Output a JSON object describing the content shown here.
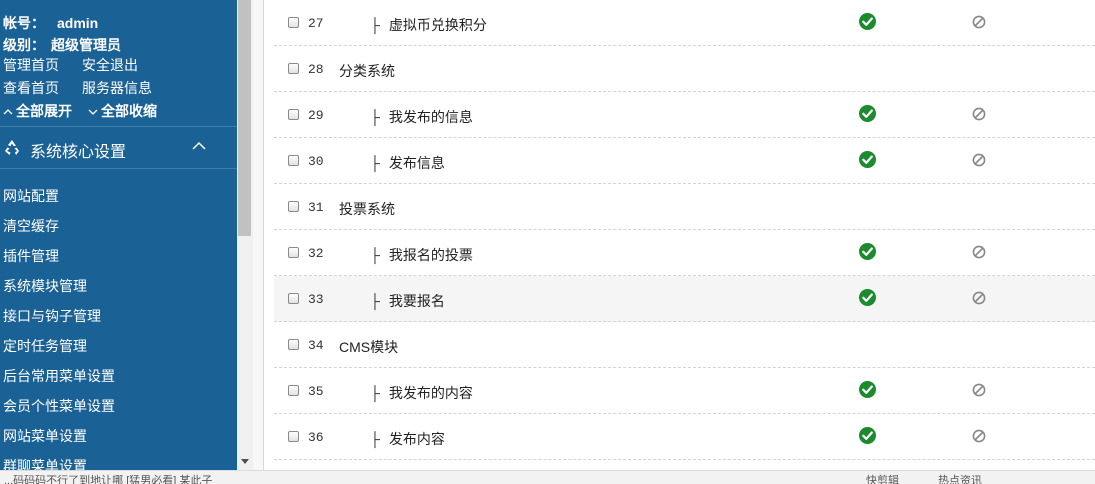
{
  "account": {
    "username_label": "帐号：",
    "username": "admin",
    "level_label": "级别：",
    "level": "超级管理员"
  },
  "quick_links": {
    "admin_home": "管理首页",
    "logout": "安全退出",
    "view_home": "查看首页",
    "server_info": "服务器信息",
    "expand_all": "全部展开",
    "collapse_all": "全部收缩"
  },
  "section": {
    "title": "系统核心设置",
    "icon": "recycle-icon"
  },
  "menu": [
    "网站配置",
    "清空缓存",
    "插件管理",
    "系统模块管理",
    "接口与钩子管理",
    "定时任务管理",
    "后台常用菜单设置",
    "会员个性菜单设置",
    "网站菜单设置",
    "群聊菜单设置"
  ],
  "rows": [
    {
      "id": "27",
      "name": "虚拟币兑换积分",
      "level": 1,
      "enabled": true
    },
    {
      "id": "28",
      "name": "分类系统",
      "level": 0,
      "enabled": false
    },
    {
      "id": "29",
      "name": "我发布的信息",
      "level": 1,
      "enabled": true
    },
    {
      "id": "30",
      "name": "发布信息",
      "level": 1,
      "enabled": true
    },
    {
      "id": "31",
      "name": "投票系统",
      "level": 0,
      "enabled": false
    },
    {
      "id": "32",
      "name": "我报名的投票",
      "level": 1,
      "enabled": true
    },
    {
      "id": "33",
      "name": "我要报名",
      "level": 1,
      "enabled": true,
      "highlighted": true
    },
    {
      "id": "34",
      "name": "CMS模块",
      "level": 0,
      "enabled": false
    },
    {
      "id": "35",
      "name": "我发布的内容",
      "level": 1,
      "enabled": true
    },
    {
      "id": "36",
      "name": "发布内容",
      "level": 1,
      "enabled": true
    }
  ],
  "tree_glyph": "├",
  "statusbar": {
    "left": "...码码码不行了到地让哪 [猛男必看]   某此子",
    "item1": "快剪辑",
    "item2": "热点资讯"
  },
  "colors": {
    "sidebar_bg": "#1a6196",
    "enabled_check": "#1c8a2e",
    "disabled_icon": "#888888"
  }
}
